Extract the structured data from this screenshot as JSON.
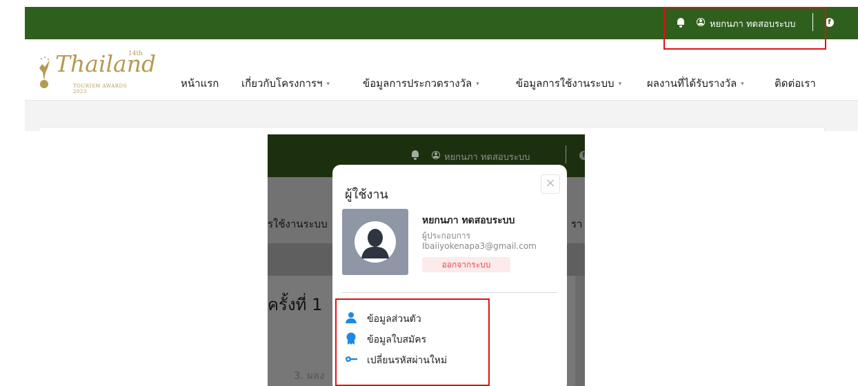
{
  "header": {
    "user_name": "หยกนภา ทดสอบระบบ",
    "facebook_glyph": "f"
  },
  "logo": {
    "word": "Thailand",
    "edition": "14th",
    "subtitle": "TOURISM AWARDS 2023"
  },
  "nav": {
    "items": [
      {
        "label": "หน้าแรก",
        "dropdown": false
      },
      {
        "label": "เกี่ยวกับโครงการฯ",
        "dropdown": true
      },
      {
        "label": "ข้อมูลการประกวดรางวัล",
        "dropdown": true
      },
      {
        "label": "ข้อมูลการใช้งานระบบ",
        "dropdown": true
      },
      {
        "label": "ผลงานที่ได้รับรางวัล",
        "dropdown": true
      },
      {
        "label": "ติดต่อเรา",
        "dropdown": false
      }
    ],
    "caret": "▾"
  },
  "background_partial": {
    "nav_fragment": "รใช้งานระบบ",
    "nav_fragment_right": "รา",
    "heading_fragment": "ครั้งที่ 1",
    "item_fragment": "3. ผลง"
  },
  "user_modal": {
    "title": "ผู้ใช้งาน",
    "close_glyph": "×",
    "name": "หยกนภา ทดสอบระบบ",
    "role": "ผู้ประกอบการ",
    "email": "Ibaiiyokenapa3@gmail.com",
    "logout_label": "ออกจากระบบ",
    "menu": [
      {
        "label": "ข้อมูลส่วนตัว",
        "icon": "user-icon"
      },
      {
        "label": "ข้อมูลใบสมัคร",
        "icon": "badge-icon"
      },
      {
        "label": "เปลี่ยนรหัสผ่านใหม่",
        "icon": "key-icon"
      }
    ]
  },
  "colors": {
    "topbar": "#2f5f1c",
    "highlight": "#e01010",
    "gold": "#b59a52",
    "logout_text": "#e14b4b",
    "icon_blue": "#1e88e5"
  }
}
